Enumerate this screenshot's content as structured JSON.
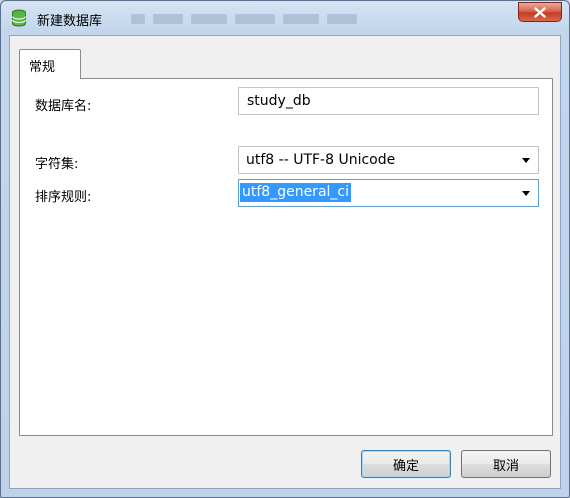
{
  "window": {
    "title": "新建数据库"
  },
  "tabs": [
    {
      "label": "常规"
    }
  ],
  "form": {
    "db_name_label": "数据库名:",
    "db_name_value": "study_db",
    "charset_label": "字符集:",
    "charset_value": "utf8 -- UTF-8 Unicode",
    "collation_label": "排序规则:",
    "collation_value": "utf8_general_ci"
  },
  "buttons": {
    "ok": "确定",
    "cancel": "取消"
  },
  "icons": {
    "app": "database-icon",
    "close": "close-icon",
    "dropdown": "chevron-down-icon"
  },
  "colors": {
    "selection": "#3399ff",
    "close_button": "#c23d22",
    "focus_border": "#5c9fd4"
  }
}
